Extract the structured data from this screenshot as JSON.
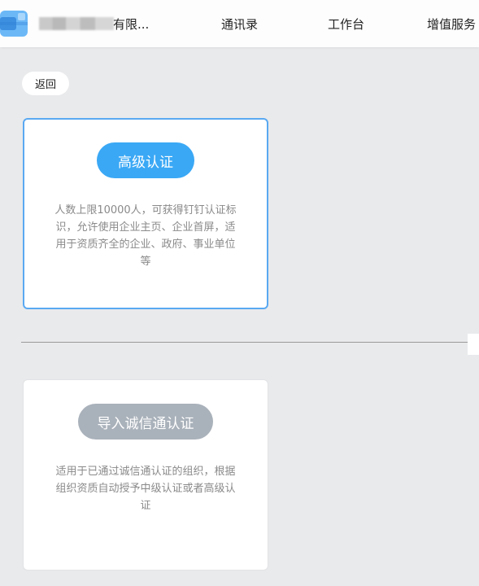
{
  "header": {
    "org_name_visible": "有限...",
    "nav": [
      "通讯录",
      "工作台",
      "增值服务"
    ]
  },
  "back_label": "返回",
  "cards": [
    {
      "button_label": "高级认证",
      "description": "人数上限10000人，可获得钉钉认证标识，允许使用企业主页、企业首屏，适用于资质齐全的企业、政府、事业单位等"
    },
    {
      "button_label": "导入诚信通认证",
      "description": "适用于已通过诚信通认证的组织，根据组织资质自动授予中级认证或者高级认证"
    }
  ],
  "colors": {
    "accent": "#3aa8f5",
    "card_border_selected": "#5aa9f2",
    "disabled_button": "#a9b1ba"
  },
  "icons": [
    "app-logo-icon"
  ]
}
